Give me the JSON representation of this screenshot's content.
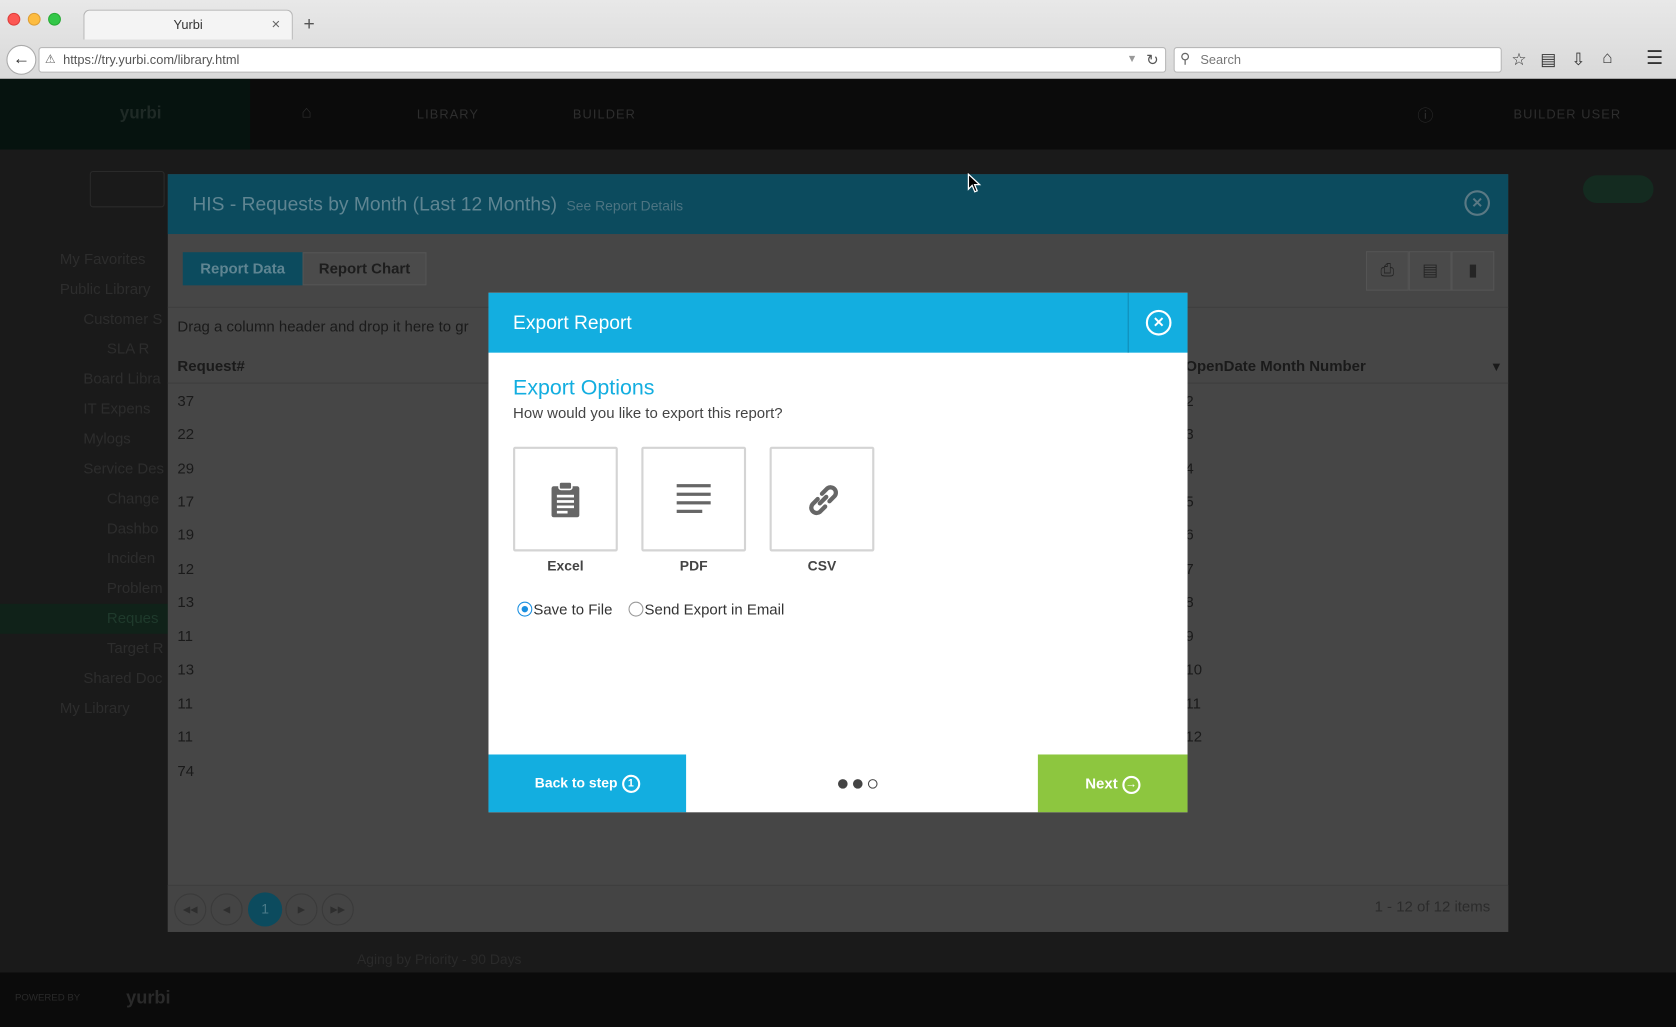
{
  "browser": {
    "tab_title": "Yurbi",
    "tab_close": "×",
    "new_tab": "+",
    "url": "https://try.yurbi.com/library.html",
    "search_placeholder": "Search"
  },
  "app": {
    "logo": "yurbi",
    "nav": [
      "LIBRARY",
      "BUILDER"
    ],
    "user": "BUILDER USER",
    "tree": [
      "My Favorites",
      "Public Library",
      "Customer S",
      "SLA R",
      "Board Libra",
      "IT Expens",
      "Mylogs",
      "Service Des",
      "Change",
      "Dashbo",
      "Inciden",
      "Problem",
      "Reques",
      "Target R",
      "Shared Doc",
      "My Library"
    ],
    "footer_powered": "POWERED BY",
    "footer_logo": "yurbi",
    "footer_row": "Aging by Priority - 90 Days"
  },
  "report_window": {
    "title": "HIS - Requests by Month (Last 12 Months)",
    "details_link": "See Report Details",
    "tabs": [
      "Report Data",
      "Report Chart"
    ],
    "drag_hint": "Drag a column header and drop it here to gr",
    "columns": [
      "Request#",
      "OpenDate Month Number"
    ],
    "request_values": [
      "37",
      "22",
      "29",
      "17",
      "19",
      "12",
      "13",
      "11",
      "13",
      "11",
      "11",
      "74"
    ],
    "month_values": [
      "2",
      "3",
      "4",
      "5",
      "6",
      "7",
      "8",
      "9",
      "10",
      "11",
      "12",
      ""
    ],
    "current_page": "1",
    "item_count": "1 - 12 of 12 items"
  },
  "modal": {
    "title": "Export Report",
    "section_title": "Export Options",
    "subtitle": "How would you like to export this report?",
    "formats": [
      {
        "label": "Excel",
        "icon": "clipboard-icon"
      },
      {
        "label": "PDF",
        "icon": "document-lines-icon"
      },
      {
        "label": "CSV",
        "icon": "link-icon"
      }
    ],
    "delivery": [
      {
        "label": "Save to File",
        "selected": true
      },
      {
        "label": "Send Export in Email",
        "selected": false
      }
    ],
    "back_label": "Back to step",
    "back_step": "1",
    "next_label": "Next",
    "steps": {
      "total": 3,
      "current": 2
    },
    "colors": {
      "primary": "#13aee0",
      "next": "#8dc63f"
    }
  }
}
